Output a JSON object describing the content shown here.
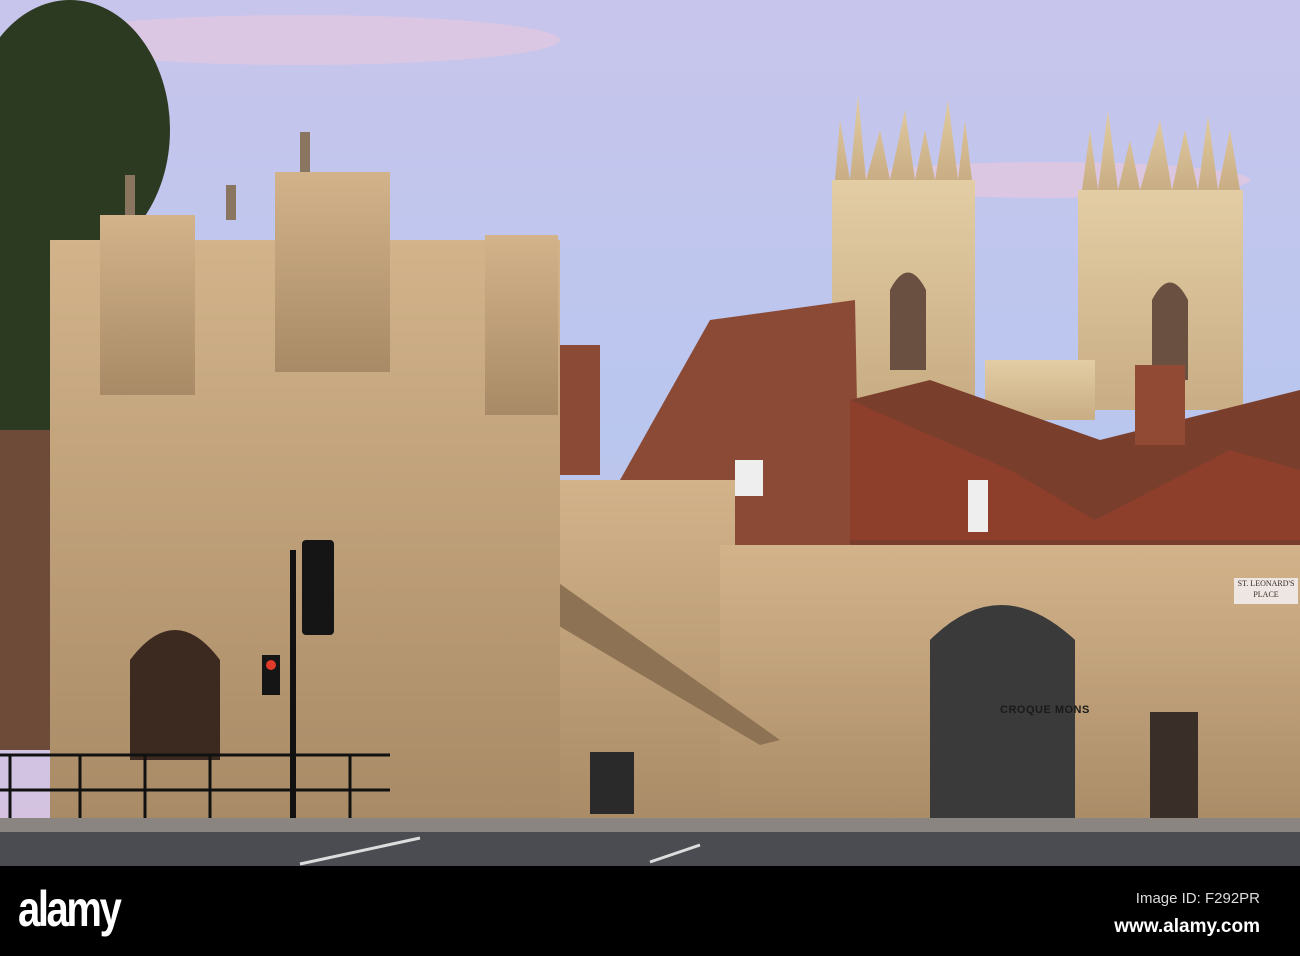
{
  "photo": {
    "street_sign": {
      "line1": "ST. LEONARD'S",
      "line2": "PLACE"
    },
    "shop_sign": "CROQUE MONS"
  },
  "footer": {
    "logo": "alamy",
    "image_id": "Image ID: F292PR",
    "website": "www.alamy.com"
  },
  "colors": {
    "sky_top": "#c9c4ea",
    "sky_pink": "#e9c6dc",
    "stone": "#c9a77c",
    "brick": "#8a4a36"
  }
}
